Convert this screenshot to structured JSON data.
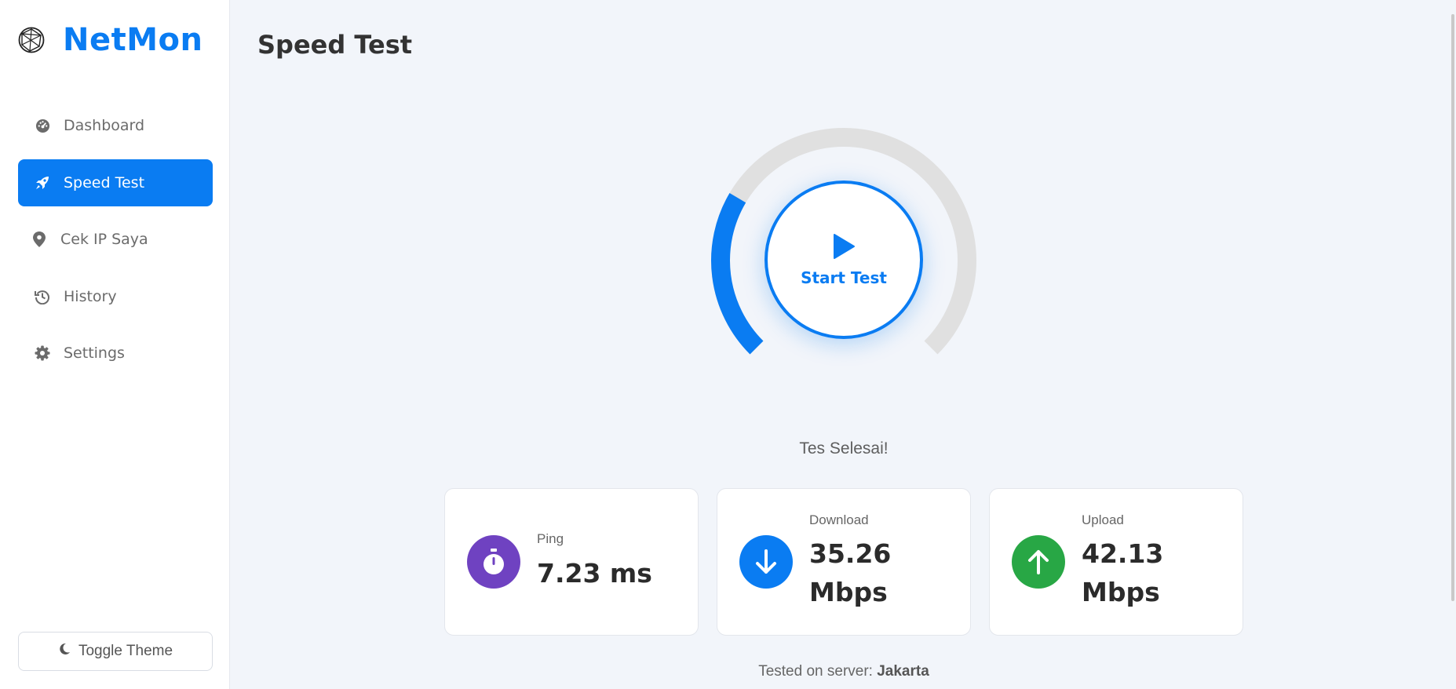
{
  "app": {
    "name": "NetMon"
  },
  "sidebar": {
    "items": [
      {
        "label": "Dashboard",
        "icon": "dashboard-gauge-icon",
        "active": false
      },
      {
        "label": "Speed Test",
        "icon": "rocket-icon",
        "active": true
      },
      {
        "label": "Cek IP Saya",
        "icon": "map-pin-icon",
        "active": false
      },
      {
        "label": "History",
        "icon": "history-icon",
        "active": false
      },
      {
        "label": "Settings",
        "icon": "gear-icon",
        "active": false
      }
    ],
    "theme_toggle": {
      "label": "Toggle Theme",
      "icon": "moon-icon"
    }
  },
  "main": {
    "title": "Speed Test",
    "gauge": {
      "progress_fraction": 0.28
    },
    "start_button": {
      "label": "Start Test",
      "icon": "play-icon"
    },
    "status": "Tes Selesai!",
    "results": {
      "ping": {
        "label": "Ping",
        "value": "7.23 ms",
        "icon": "stopwatch-icon",
        "color": "#6f42c1"
      },
      "download": {
        "label": "Download",
        "value_number": "35.26",
        "value_unit": "Mbps",
        "icon": "arrow-down-icon",
        "color": "#0a7cf2"
      },
      "upload": {
        "label": "Upload",
        "value_number": "42.13",
        "value_unit": "Mbps",
        "icon": "arrow-up-icon",
        "color": "#28a745"
      }
    },
    "server": {
      "prefix": "Tested on server:",
      "name": "Jakarta"
    }
  },
  "colors": {
    "accent": "#0a7cf2",
    "background": "#f2f5fa",
    "track": "#e0e0e0"
  }
}
